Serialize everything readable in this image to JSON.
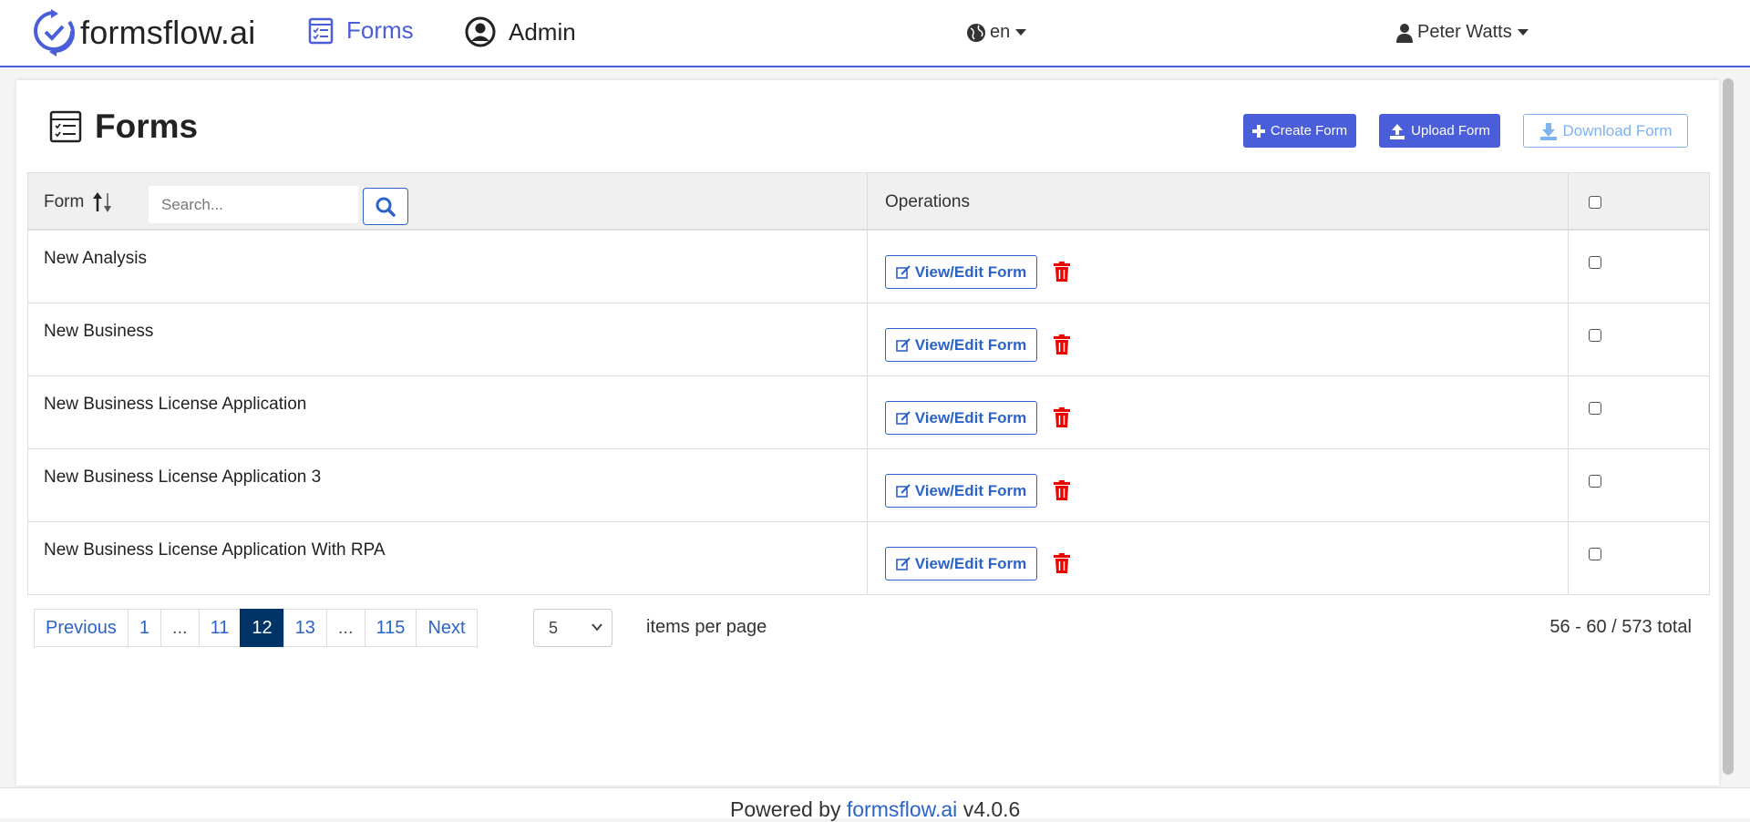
{
  "navbar": {
    "brand": "formsflow.ai",
    "nav_forms": "Forms",
    "nav_admin": "Admin",
    "language": "en",
    "user": "Peter Watts",
    "accent_color": "#4a5ed9"
  },
  "page": {
    "title": "Forms",
    "create_label": "Create Form",
    "upload_label": "Upload Form",
    "download_label": "Download Form"
  },
  "table": {
    "col_form": "Form",
    "search_placeholder": "Search...",
    "col_operations": "Operations",
    "view_edit_label": "View/Edit Form",
    "rows": [
      {
        "name": "New Analysis"
      },
      {
        "name": "New Business"
      },
      {
        "name": "New Business License Application"
      },
      {
        "name": "New Business License Application 3"
      },
      {
        "name": "New Business License Application With RPA"
      }
    ]
  },
  "pagination": {
    "previous": "Previous",
    "pages": [
      "1",
      "...",
      "11",
      "12",
      "13",
      "...",
      "115"
    ],
    "active_page": "12",
    "next": "Next",
    "per_page_value": "5",
    "per_page_label": "items per page",
    "total": "56 - 60 / 573 total"
  },
  "footer": {
    "prefix": "Powered by",
    "link": "formsflow.ai",
    "version": "v4.0.6"
  }
}
